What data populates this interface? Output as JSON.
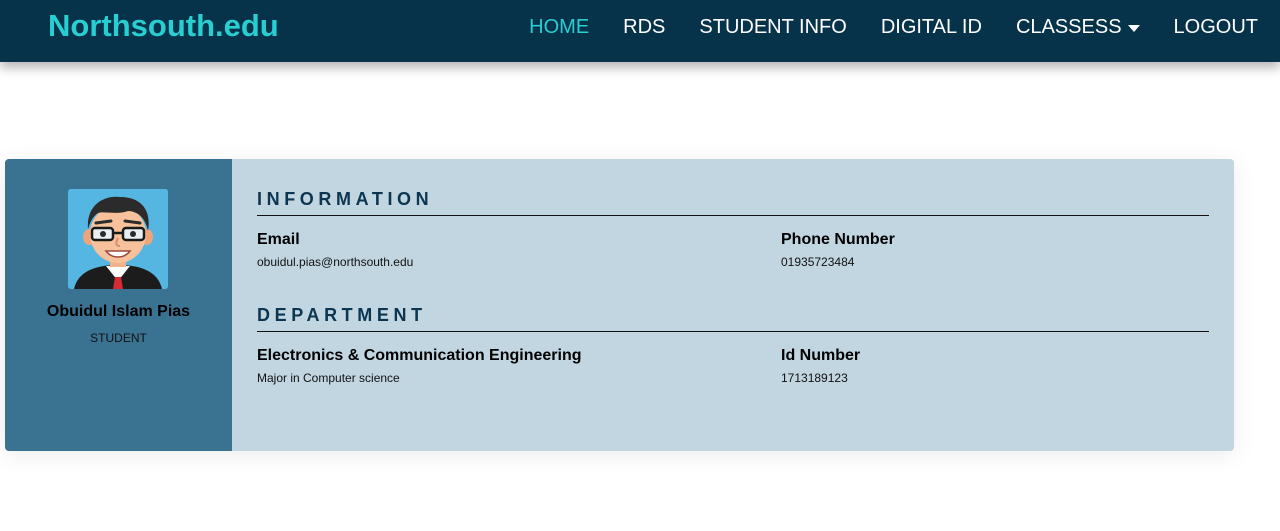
{
  "nav": {
    "brand": "Northsouth.edu",
    "links": [
      {
        "label": "HOME",
        "active": true
      },
      {
        "label": "RDS"
      },
      {
        "label": "STUDENT INFO"
      },
      {
        "label": "DIGITAL ID"
      },
      {
        "label": "CLASSESS",
        "dropdown": true
      },
      {
        "label": "LOGOUT"
      }
    ]
  },
  "profile": {
    "name": "Obuidul Islam Pias",
    "role": "STUDENT",
    "avatar_icon": "cartoon-avatar-glasses-icon"
  },
  "information": {
    "title": "INFORMATION",
    "email_label": "Email",
    "email_value": "obuidul.pias@northsouth.edu",
    "phone_label": "Phone Number",
    "phone_value": "01935723484"
  },
  "department": {
    "title": "DEPARTMENT",
    "dept_label": "Electronics & Communication Engineering",
    "dept_value": "Major in Computer science",
    "id_label": "Id Number",
    "id_value": "1713189123"
  },
  "colors": {
    "navbar": "#06324a",
    "accent": "#28cfd2",
    "sidebar": "#3a7291",
    "panel": "#c1d6e1",
    "heading": "#0b3550"
  }
}
